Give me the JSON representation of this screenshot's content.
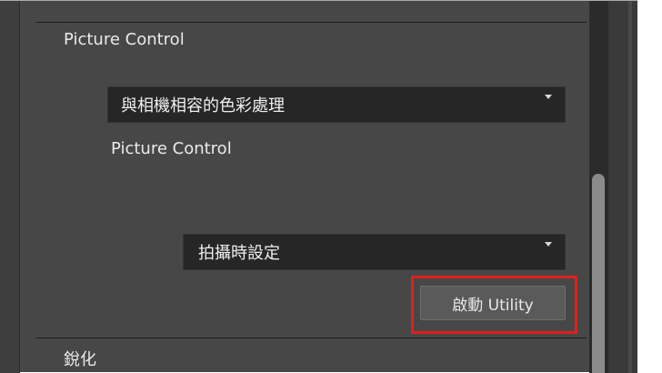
{
  "section": {
    "title": "Picture Control"
  },
  "color_processing": {
    "dropdown_value": "與相機相容的色彩處理",
    "caret_icon": "chevron-down-icon"
  },
  "picture_control": {
    "label": "Picture Control",
    "dropdown_value": "拍攝時設定",
    "caret_icon": "chevron-down-icon",
    "launch_button_label": "啟動 Utility"
  },
  "next_section": {
    "title": "銳化"
  },
  "colors": {
    "panel_bg": "#4d4d4d",
    "dropdown_bg": "#262626",
    "highlight": "#e0201e"
  }
}
